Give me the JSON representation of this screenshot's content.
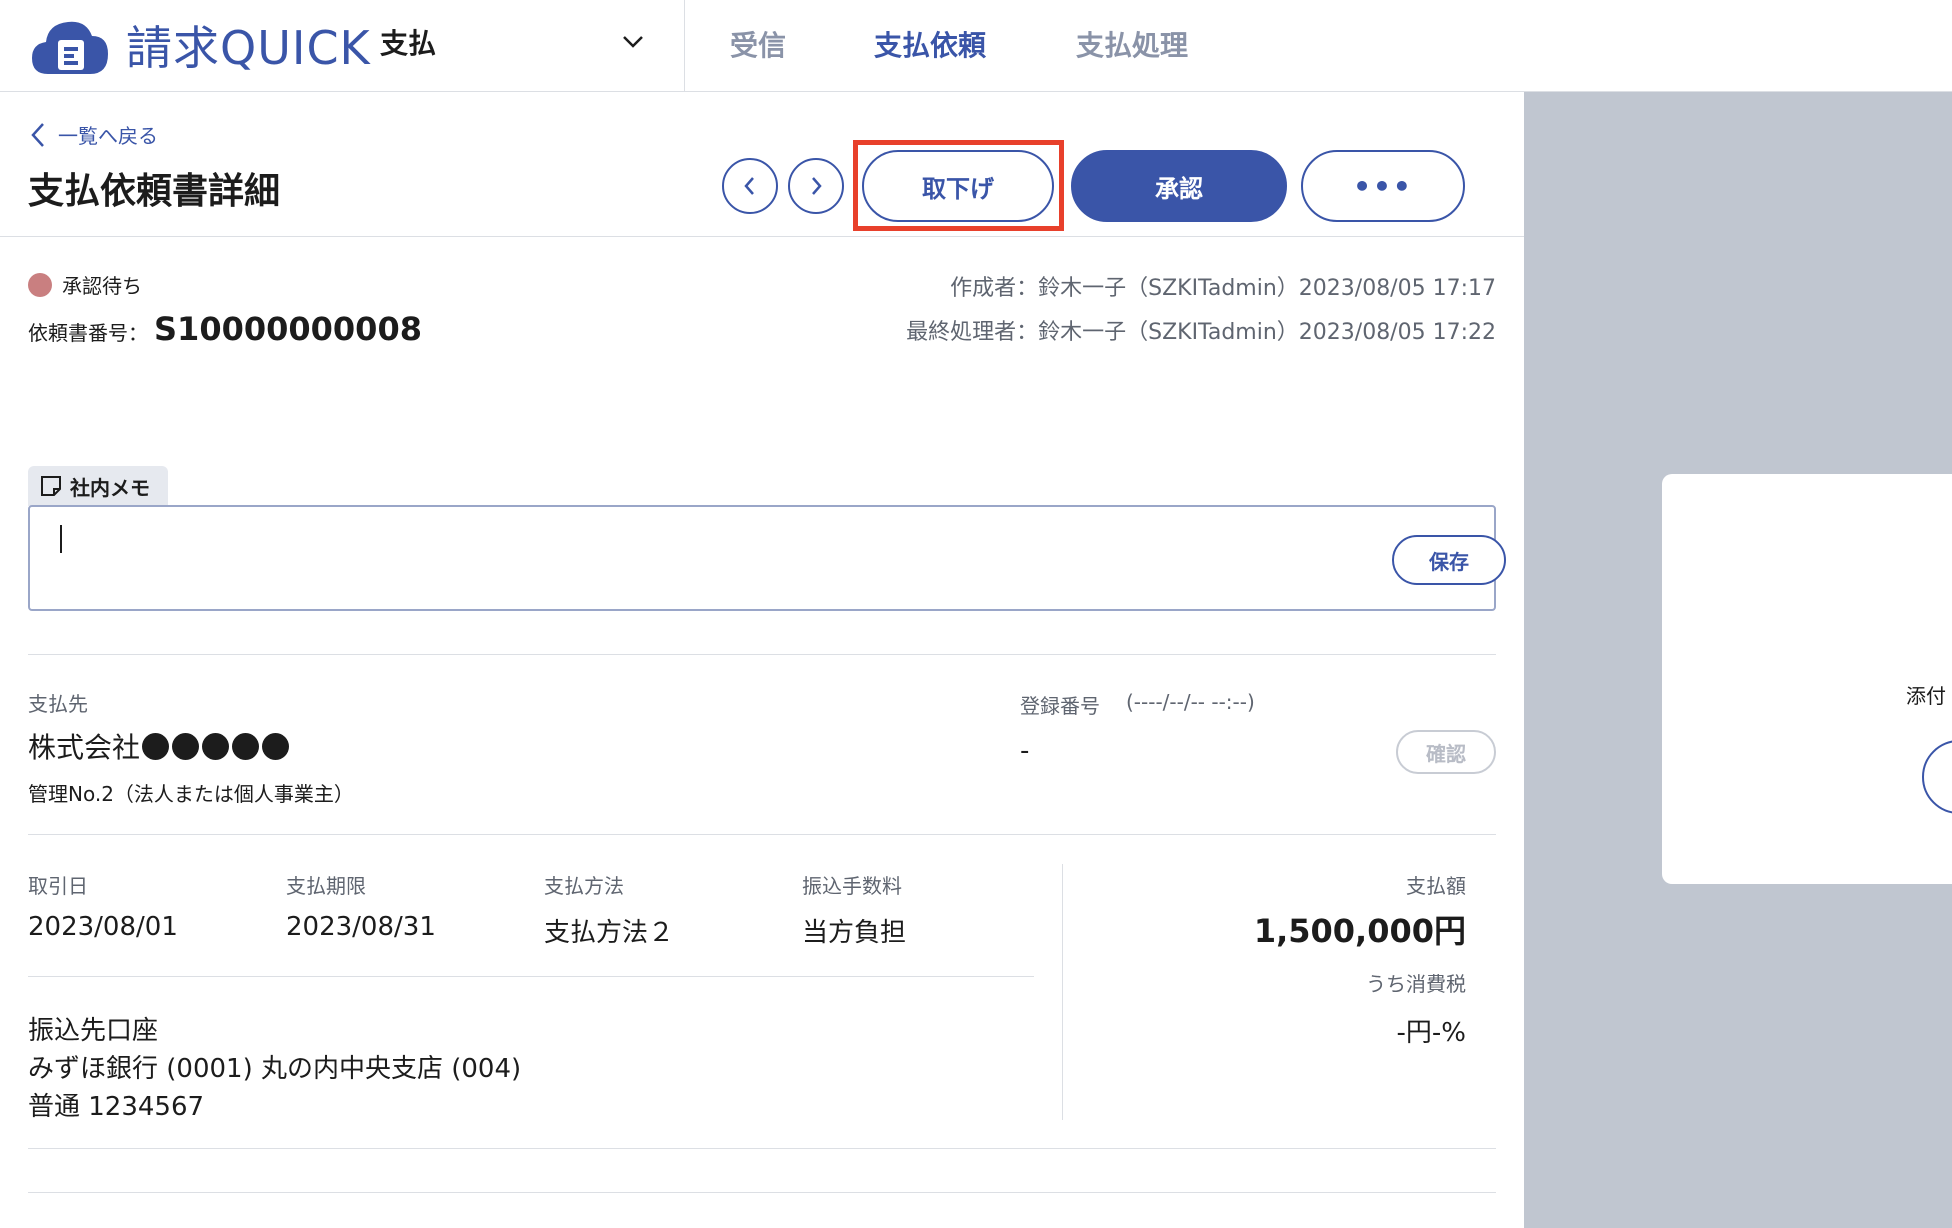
{
  "header": {
    "logo_text": "請求QUICK",
    "module": "支払",
    "tabs": [
      {
        "label": "受信",
        "active": false
      },
      {
        "label": "支払依頼",
        "active": true
      },
      {
        "label": "支払処理",
        "active": false
      }
    ]
  },
  "page": {
    "back_label": "一覧へ戻る",
    "title": "支払依頼書詳細"
  },
  "toolbar": {
    "withdraw_label": "取下げ",
    "approve_label": "承認",
    "more_label": "•••"
  },
  "status": {
    "label": "承認待ち",
    "color": "#c97f80"
  },
  "request": {
    "number_label": "依頼書番号：",
    "number": "S10000000008",
    "creator": "作成者：鈴木一子（SZKITadmin）2023/08/05 17:17",
    "last_processor": "最終処理者：鈴木一子（SZKITadmin）2023/08/05 17:22"
  },
  "memo": {
    "tab_label": "社内メモ",
    "value": "",
    "save_label": "保存"
  },
  "payee": {
    "label": "支払先",
    "name_prefix": "株式会社",
    "management": "管理No.2（法人または個人事業主）",
    "registration_label": "登録番号",
    "registration_date": "(----/--/-- --:--)",
    "registration_value": "-",
    "confirm_label": "確認"
  },
  "details": {
    "transaction_date_label": "取引日",
    "transaction_date": "2023/08/01",
    "due_date_label": "支払期限",
    "due_date": "2023/08/31",
    "method_label": "支払方法",
    "method": "支払方法２",
    "fee_label": "振込手数料",
    "fee": "当方負担",
    "account_label": "振込先口座",
    "account_bank": "みずほ銀行 (0001) 丸の内中央支店 (004)",
    "account_number": "普通 1234567",
    "amount_label": "支払額",
    "amount": "1,500,000円",
    "tax_label": "うち消費税",
    "tax_value": "-円-%"
  },
  "side_panel": {
    "attachment_label": "添付"
  },
  "colors": {
    "accent": "#3a55a8",
    "highlight": "#e8402b",
    "panel_bg": "#c0c6d0"
  }
}
